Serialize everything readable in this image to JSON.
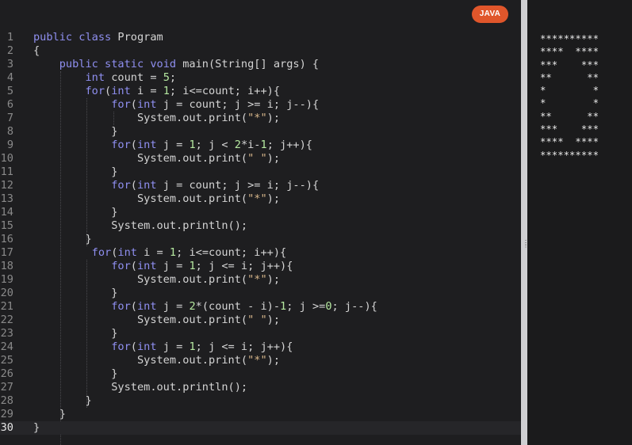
{
  "language_badge": "JAVA",
  "code_lines": [
    [
      {
        "t": "public ",
        "c": "k"
      },
      {
        "t": "class ",
        "c": "k"
      },
      {
        "t": "Program",
        "c": "p"
      }
    ],
    [
      {
        "t": "{",
        "c": "p"
      }
    ],
    [
      {
        "t": "    public ",
        "c": "k"
      },
      {
        "t": "static ",
        "c": "k"
      },
      {
        "t": "void ",
        "c": "k"
      },
      {
        "t": "main(String[] args) {",
        "c": "p"
      }
    ],
    [
      {
        "t": "        int ",
        "c": "k"
      },
      {
        "t": "count = ",
        "c": "p"
      },
      {
        "t": "5",
        "c": "n"
      },
      {
        "t": ";",
        "c": "p"
      }
    ],
    [
      {
        "t": "        for",
        "c": "k"
      },
      {
        "t": "(",
        "c": "p"
      },
      {
        "t": "int ",
        "c": "k"
      },
      {
        "t": "i = ",
        "c": "p"
      },
      {
        "t": "1",
        "c": "n"
      },
      {
        "t": "; i<=count; i++){",
        "c": "p"
      }
    ],
    [
      {
        "t": "            for",
        "c": "k"
      },
      {
        "t": "(",
        "c": "p"
      },
      {
        "t": "int ",
        "c": "k"
      },
      {
        "t": "j = count; j >= i; j--){",
        "c": "p"
      }
    ],
    [
      {
        "t": "                System.out.print(",
        "c": "p"
      },
      {
        "t": "\"*\"",
        "c": "s"
      },
      {
        "t": ");",
        "c": "p"
      }
    ],
    [
      {
        "t": "            }",
        "c": "p"
      }
    ],
    [
      {
        "t": "            for",
        "c": "k"
      },
      {
        "t": "(",
        "c": "p"
      },
      {
        "t": "int ",
        "c": "k"
      },
      {
        "t": "j = ",
        "c": "p"
      },
      {
        "t": "1",
        "c": "n"
      },
      {
        "t": "; j < ",
        "c": "p"
      },
      {
        "t": "2",
        "c": "n"
      },
      {
        "t": "*i-",
        "c": "p"
      },
      {
        "t": "1",
        "c": "n"
      },
      {
        "t": "; j++){",
        "c": "p"
      }
    ],
    [
      {
        "t": "                System.out.print(",
        "c": "p"
      },
      {
        "t": "\" \"",
        "c": "s"
      },
      {
        "t": ");",
        "c": "p"
      }
    ],
    [
      {
        "t": "            }",
        "c": "p"
      }
    ],
    [
      {
        "t": "            for",
        "c": "k"
      },
      {
        "t": "(",
        "c": "p"
      },
      {
        "t": "int ",
        "c": "k"
      },
      {
        "t": "j = count; j >= i; j--){",
        "c": "p"
      }
    ],
    [
      {
        "t": "                System.out.print(",
        "c": "p"
      },
      {
        "t": "\"*\"",
        "c": "s"
      },
      {
        "t": ");",
        "c": "p"
      }
    ],
    [
      {
        "t": "            }",
        "c": "p"
      }
    ],
    [
      {
        "t": "            System.out.println();",
        "c": "p"
      }
    ],
    [
      {
        "t": "        }",
        "c": "p"
      }
    ],
    [
      {
        "t": "         for",
        "c": "k"
      },
      {
        "t": "(",
        "c": "p"
      },
      {
        "t": "int ",
        "c": "k"
      },
      {
        "t": "i = ",
        "c": "p"
      },
      {
        "t": "1",
        "c": "n"
      },
      {
        "t": "; i<=count; i++){",
        "c": "p"
      }
    ],
    [
      {
        "t": "            for",
        "c": "k"
      },
      {
        "t": "(",
        "c": "p"
      },
      {
        "t": "int ",
        "c": "k"
      },
      {
        "t": "j = ",
        "c": "p"
      },
      {
        "t": "1",
        "c": "n"
      },
      {
        "t": "; j <= i; j++){",
        "c": "p"
      }
    ],
    [
      {
        "t": "                System.out.print(",
        "c": "p"
      },
      {
        "t": "\"*\"",
        "c": "s"
      },
      {
        "t": ");",
        "c": "p"
      }
    ],
    [
      {
        "t": "            }",
        "c": "p"
      }
    ],
    [
      {
        "t": "            for",
        "c": "k"
      },
      {
        "t": "(",
        "c": "p"
      },
      {
        "t": "int ",
        "c": "k"
      },
      {
        "t": "j = ",
        "c": "p"
      },
      {
        "t": "2",
        "c": "n"
      },
      {
        "t": "*(count - i)-",
        "c": "p"
      },
      {
        "t": "1",
        "c": "n"
      },
      {
        "t": "; j >=",
        "c": "p"
      },
      {
        "t": "0",
        "c": "n"
      },
      {
        "t": "; j--){",
        "c": "p"
      }
    ],
    [
      {
        "t": "                System.out.print(",
        "c": "p"
      },
      {
        "t": "\" \"",
        "c": "s"
      },
      {
        "t": ");",
        "c": "p"
      }
    ],
    [
      {
        "t": "            }",
        "c": "p"
      }
    ],
    [
      {
        "t": "            for",
        "c": "k"
      },
      {
        "t": "(",
        "c": "p"
      },
      {
        "t": "int ",
        "c": "k"
      },
      {
        "t": "j = ",
        "c": "p"
      },
      {
        "t": "1",
        "c": "n"
      },
      {
        "t": "; j <= i; j++){",
        "c": "p"
      }
    ],
    [
      {
        "t": "                System.out.print(",
        "c": "p"
      },
      {
        "t": "\"*\"",
        "c": "s"
      },
      {
        "t": ");",
        "c": "p"
      }
    ],
    [
      {
        "t": "            }",
        "c": "p"
      }
    ],
    [
      {
        "t": "            System.out.println();",
        "c": "p"
      }
    ],
    [
      {
        "t": "        }",
        "c": "p"
      }
    ],
    [
      {
        "t": "    }",
        "c": "p"
      }
    ],
    [
      {
        "t": "}",
        "c": "p"
      }
    ]
  ],
  "active_line": 30,
  "output_lines": [
    "**********",
    "****  ****",
    "***    ***",
    "**      **",
    "*        *",
    "*        *",
    "**      **",
    "***    ***",
    "****  ****",
    "**********"
  ],
  "colors": {
    "keyword": "#8f8ff0",
    "number": "#b5e8a0",
    "string": "#d7b68a",
    "badge": "#e0562b"
  }
}
